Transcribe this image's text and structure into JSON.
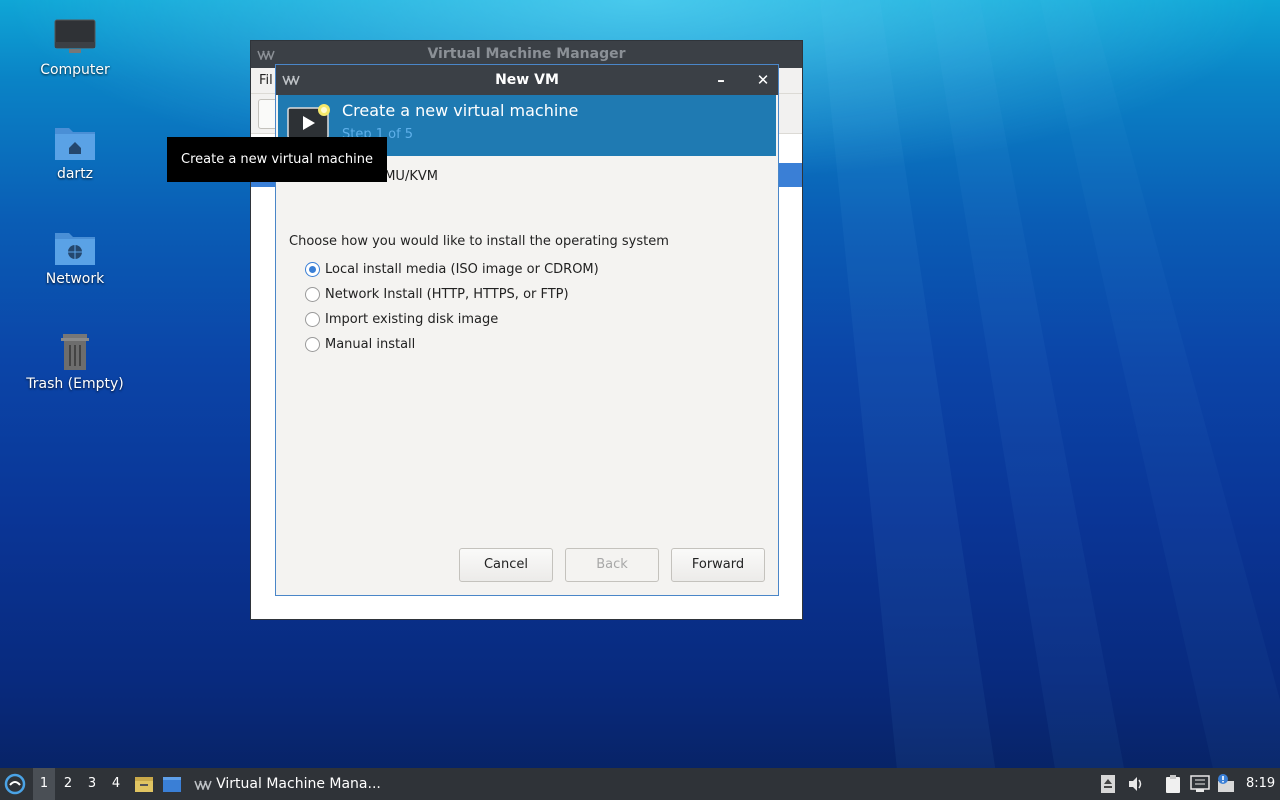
{
  "desktop": {
    "icons": [
      {
        "label": "Computer"
      },
      {
        "label": "dartz"
      },
      {
        "label": "Network"
      },
      {
        "label": "Trash (Empty)"
      }
    ]
  },
  "vmm_window": {
    "title": "Virtual Machine Manager",
    "menu_partial": "Fil"
  },
  "dialog": {
    "title": "New VM",
    "header_title": "Create a new virtual machine",
    "header_step": "Step 1 of 5",
    "connection_partial": "EMU/KVM",
    "install_question": "Choose how you would like to install the operating system",
    "options": [
      {
        "label": "Local install media (ISO image or CDROM)",
        "checked": true
      },
      {
        "label": "Network Install (HTTP, HTTPS, or FTP)",
        "checked": false
      },
      {
        "label": "Import existing disk image",
        "checked": false
      },
      {
        "label": "Manual install",
        "checked": false
      }
    ],
    "buttons": {
      "cancel": "Cancel",
      "back": "Back",
      "forward": "Forward"
    },
    "minimize_glyph": "–",
    "close_glyph": "✕"
  },
  "tooltip": {
    "text": "Create a new virtual machine"
  },
  "taskbar": {
    "workspaces": [
      "1",
      "2",
      "3",
      "4"
    ],
    "active_workspace": "1",
    "task_label": "Virtual Machine Mana...",
    "clock": "8:19"
  },
  "colors": {
    "header_band": "#1f7ab2",
    "accent": "#3a7fd6",
    "titlebar": "#3b4046",
    "taskbar": "#2f3338"
  }
}
